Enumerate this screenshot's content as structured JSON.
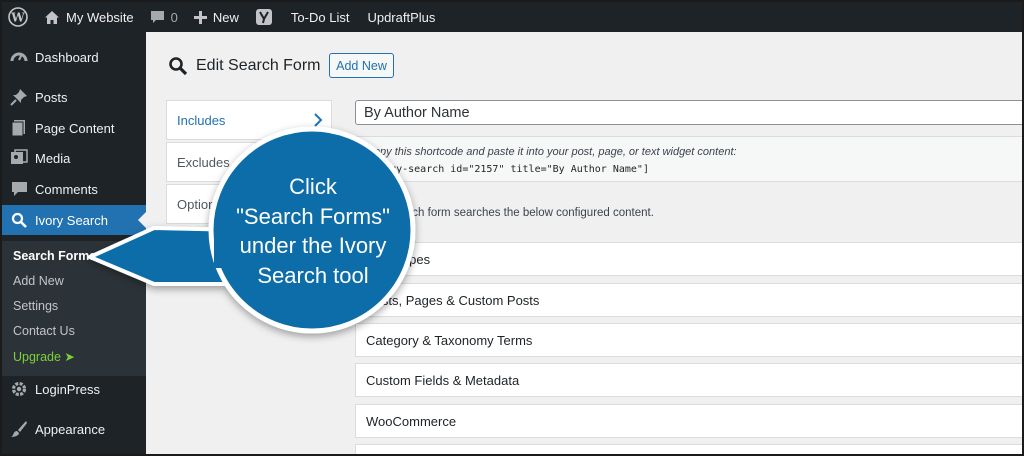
{
  "admin_bar": {
    "site_name": "My Website",
    "comments_count": "0",
    "new_label": "New",
    "todo_label": "To-Do List",
    "updraft_label": "UpdraftPlus"
  },
  "sidebar": {
    "items": [
      {
        "label": "Dashboard",
        "icon": "dashboard-icon"
      },
      {
        "label": "Posts",
        "icon": "pin-icon"
      },
      {
        "label": "Page Content",
        "icon": "page-icon"
      },
      {
        "label": "Media",
        "icon": "media-icon"
      },
      {
        "label": "Comments",
        "icon": "comment-icon"
      },
      {
        "label": "Ivory Search",
        "icon": "search-icon"
      },
      {
        "label": "LoginPress",
        "icon": "gear-icon"
      },
      {
        "label": "Appearance",
        "icon": "paintbrush-icon"
      }
    ],
    "submenu": [
      "Search Forms",
      "Add New",
      "Settings",
      "Contact Us",
      "Upgrade ➤"
    ]
  },
  "page": {
    "title": "Edit Search Form",
    "add_new_label": "Add New"
  },
  "tabs": [
    "Includes",
    "Excludes",
    "Options"
  ],
  "form": {
    "title_value": "By Author Name",
    "shortcode_note": "Copy this shortcode and paste it into your post, page, or text widget content:",
    "shortcode": "[ivory-search id=\"2157\" title=\"By Author Name\"]",
    "searches_note": "This search form searches the below configured content."
  },
  "sections": [
    "Post Types",
    "Posts, Pages & Custom Posts",
    "Category & Taxonomy Terms",
    "Custom Fields & Metadata",
    "WooCommerce"
  ],
  "callout": {
    "lines": [
      "Click",
      "\"Search Forms\"",
      "under the Ivory",
      "Search tool"
    ]
  },
  "colors": {
    "admin_dark": "#1d2327",
    "accent_blue": "#2271b1",
    "callout_blue": "#0f6da8",
    "upgrade_green": "#7ad03a"
  }
}
